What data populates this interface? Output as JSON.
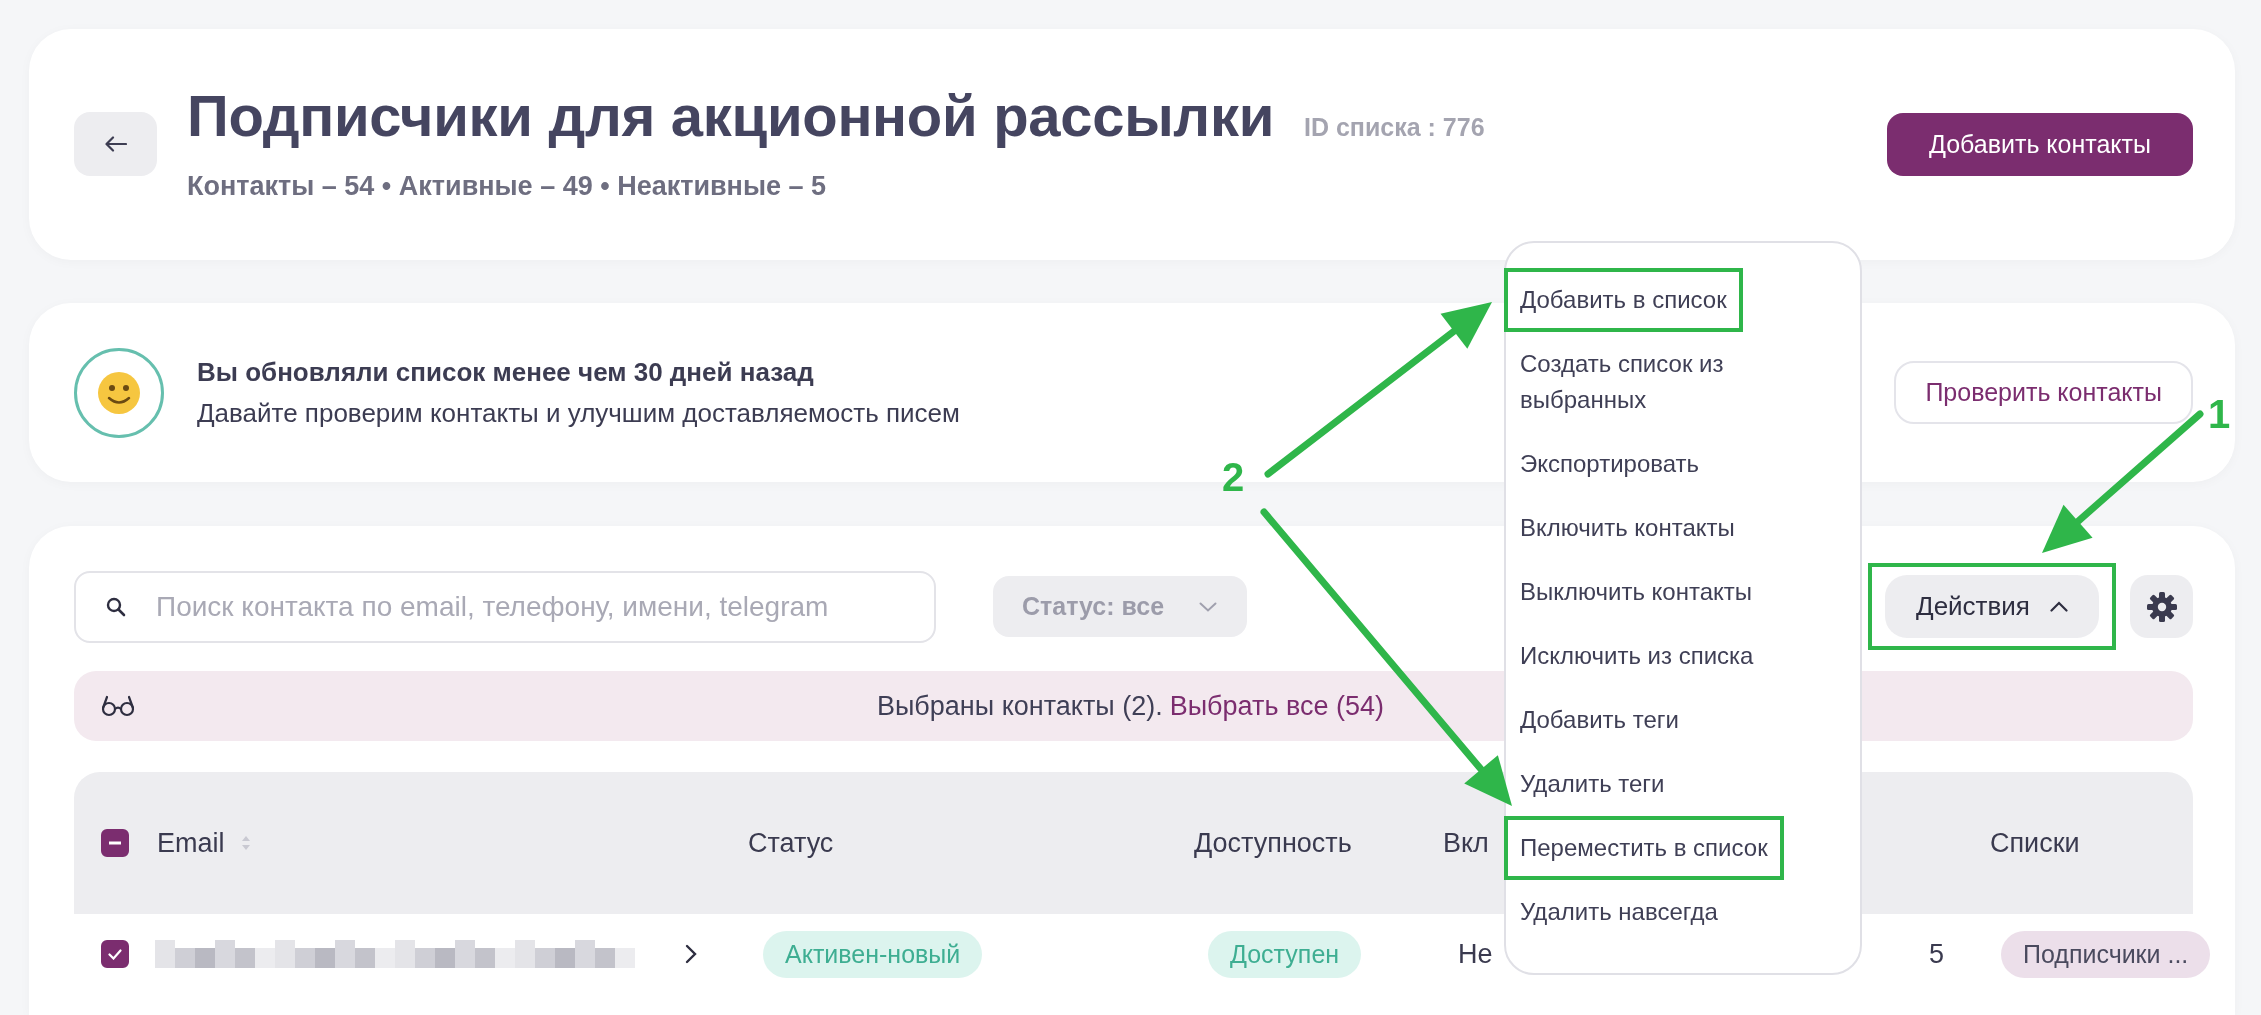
{
  "header": {
    "title": "Подписчики для акционной рассылки",
    "list_id": "ID списка : 776",
    "stats": "Контакты – 54 • Активные – 49 • Неактивные – 5",
    "add_button": "Добавить контакты"
  },
  "notice": {
    "title": "Вы обновляли список менее чем 30 дней назад",
    "text": "Давайте проверим контакты и улучшим доставляемость писем",
    "button": "Проверить контакты"
  },
  "toolbar": {
    "search": {
      "placeholder": "Поиск контакта по email, телефону, имени, telegram"
    },
    "status_filter": "Статус: все",
    "actions": {
      "label": "Действия",
      "expanded": true,
      "highlighted": true
    }
  },
  "selection": {
    "text": "Выбраны контакты (2).",
    "link": "Выбрать все (54)"
  },
  "table": {
    "select_all_checked": true,
    "select_all_partial": true,
    "columns": [
      {
        "label": "Email",
        "sortable": true
      },
      {
        "label": "Статус",
        "sortable": false
      },
      {
        "label": "Доступность",
        "sortable": false
      },
      {
        "label": "Вкл"
      },
      {
        "label": "Списки",
        "sortable": false
      }
    ],
    "rows": [
      {
        "checked": true,
        "status": "Активен-новый",
        "availability": "Доступен",
        "column_4": "Не",
        "column_5": "5",
        "lists": "Подписчики ..."
      }
    ]
  },
  "menu": {
    "items": [
      {
        "label": "Добавить в список",
        "highlighted": true
      },
      {
        "label": "Создать список из выбранных",
        "highlighted": false
      },
      {
        "label": "Экспортировать",
        "highlighted": false
      },
      {
        "label": "Включить контакты",
        "highlighted": false
      },
      {
        "label": "Выключить контакты",
        "highlighted": false
      },
      {
        "label": "Исключить из списка",
        "highlighted": false
      },
      {
        "label": "Добавить теги",
        "highlighted": false
      },
      {
        "label": "Удалить теги",
        "highlighted": false
      },
      {
        "label": "Переместить в список",
        "highlighted": true
      },
      {
        "label": "Удалить навсегда",
        "highlighted": false
      }
    ]
  },
  "annotations": [
    {
      "label": "1"
    },
    {
      "label": "2"
    }
  ]
}
